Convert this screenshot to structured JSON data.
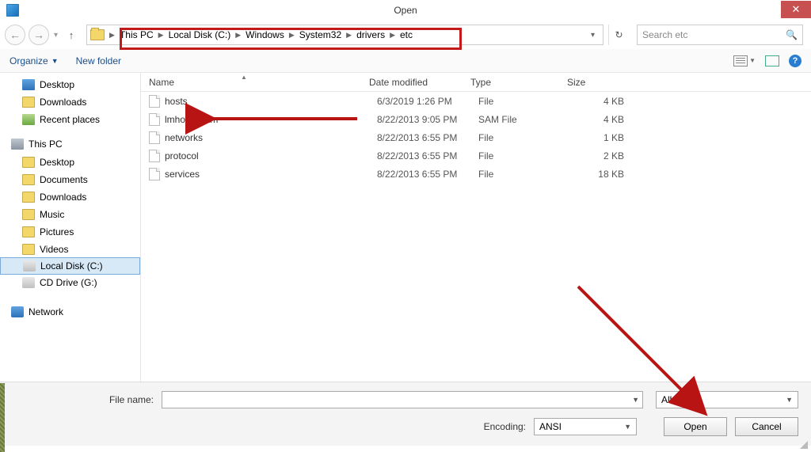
{
  "window": {
    "title": "Open"
  },
  "breadcrumb": {
    "segments": [
      "This PC",
      "Local Disk (C:)",
      "Windows",
      "System32",
      "drivers",
      "etc"
    ]
  },
  "search": {
    "placeholder": "Search etc"
  },
  "toolbar": {
    "organize": "Organize",
    "newfolder": "New folder"
  },
  "tree": {
    "quick": [
      {
        "label": "Desktop",
        "icon": "ic-desktop"
      },
      {
        "label": "Downloads",
        "icon": "ic-folder"
      },
      {
        "label": "Recent places",
        "icon": "ic-recent"
      }
    ],
    "thispc_label": "This PC",
    "thispc": [
      {
        "label": "Desktop",
        "icon": "ic-folder"
      },
      {
        "label": "Documents",
        "icon": "ic-folder"
      },
      {
        "label": "Downloads",
        "icon": "ic-folder"
      },
      {
        "label": "Music",
        "icon": "ic-folder"
      },
      {
        "label": "Pictures",
        "icon": "ic-folder"
      },
      {
        "label": "Videos",
        "icon": "ic-folder"
      },
      {
        "label": "Local Disk (C:)",
        "icon": "ic-drive",
        "selected": true
      },
      {
        "label": "CD Drive (G:)",
        "icon": "ic-drive"
      }
    ],
    "network_label": "Network"
  },
  "columns": {
    "name": "Name",
    "date": "Date modified",
    "type": "Type",
    "size": "Size"
  },
  "files": [
    {
      "name": "hosts",
      "date": "6/3/2019 1:26 PM",
      "type": "File",
      "size": "4 KB"
    },
    {
      "name": "lmhosts.sam",
      "date": "8/22/2013 9:05 PM",
      "type": "SAM File",
      "size": "4 KB"
    },
    {
      "name": "networks",
      "date": "8/22/2013 6:55 PM",
      "type": "File",
      "size": "1 KB"
    },
    {
      "name": "protocol",
      "date": "8/22/2013 6:55 PM",
      "type": "File",
      "size": "2 KB"
    },
    {
      "name": "services",
      "date": "8/22/2013 6:55 PM",
      "type": "File",
      "size": "18 KB"
    }
  ],
  "bottom": {
    "filename_label": "File name:",
    "filename_value": "",
    "filter_label": "All Files",
    "encoding_label": "Encoding:",
    "encoding_value": "ANSI",
    "open": "Open",
    "cancel": "Cancel"
  }
}
